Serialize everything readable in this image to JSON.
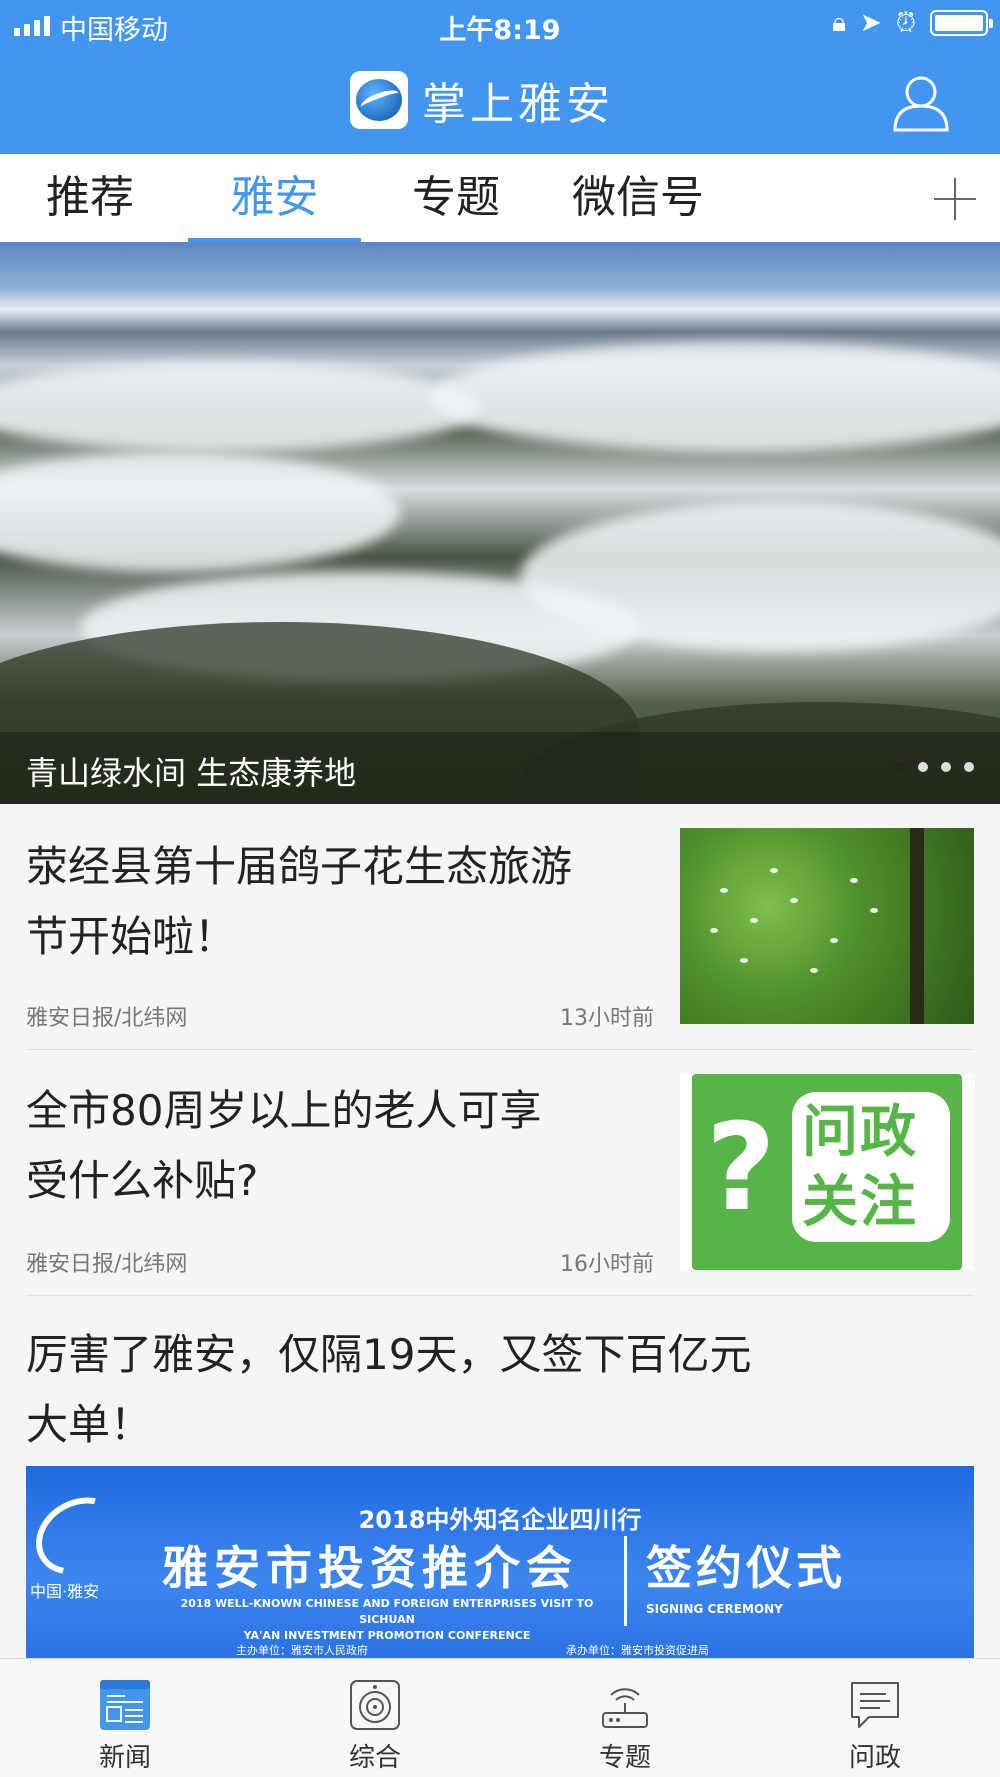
{
  "status_bar": {
    "carrier": "中国移动",
    "time": "上午8:19"
  },
  "header": {
    "app_title": "掌上雅安",
    "logo_icon": "app-logo-icon",
    "user_icon": "user-profile-icon"
  },
  "tabs": {
    "items": [
      {
        "label": "推荐",
        "active": false
      },
      {
        "label": "雅安",
        "active": true
      },
      {
        "label": "专题",
        "active": false
      },
      {
        "label": "微信号",
        "active": false
      }
    ],
    "add_icon": "plus-icon",
    "accent_color": "#4396f0"
  },
  "banner": {
    "caption": "青山绿水间 生态康养地",
    "slide_count": 4,
    "active_slide": 1
  },
  "news": [
    {
      "title_lines": [
        "荥经县第十届鸽子花生态旅游",
        "节开始啦！"
      ],
      "source": "雅安日报/北纬网",
      "time": "13小时前"
    },
    {
      "title_lines": [
        "全市80周岁以上的老人可享",
        "受什么补贴?"
      ],
      "source": "雅安日报/北纬网",
      "time": "16小时前",
      "thumb_text": [
        "问政",
        "关注"
      ]
    },
    {
      "title_lines": [
        "厉害了雅安，仅隔19天，又签下百亿元",
        "大单！"
      ],
      "poster": {
        "brand": "中国·雅安",
        "year_line": "2018中外知名企业四川行",
        "main": "雅安市投资推介会",
        "sign": "签约仪式",
        "en_lines": [
          "2018 WELL-KNOWN CHINESE AND FOREIGN ENTERPRISES VISIT TO SICHUAN",
          "YA'AN INVESTMENT PROMOTION CONFERENCE"
        ],
        "sign_en": "SIGNING CEREMONY",
        "host": "主办单位：雅安市人民政府",
        "organizer": "承办单位：雅安市投资促进局"
      }
    }
  ],
  "bottom_tabs": [
    {
      "label": "新闻",
      "icon": "newspaper-icon",
      "active": true
    },
    {
      "label": "综合",
      "icon": "speaker-icon",
      "active": false
    },
    {
      "label": "专题",
      "icon": "router-icon",
      "active": false
    },
    {
      "label": "问政",
      "icon": "chat-bubble-icon",
      "active": false
    }
  ]
}
